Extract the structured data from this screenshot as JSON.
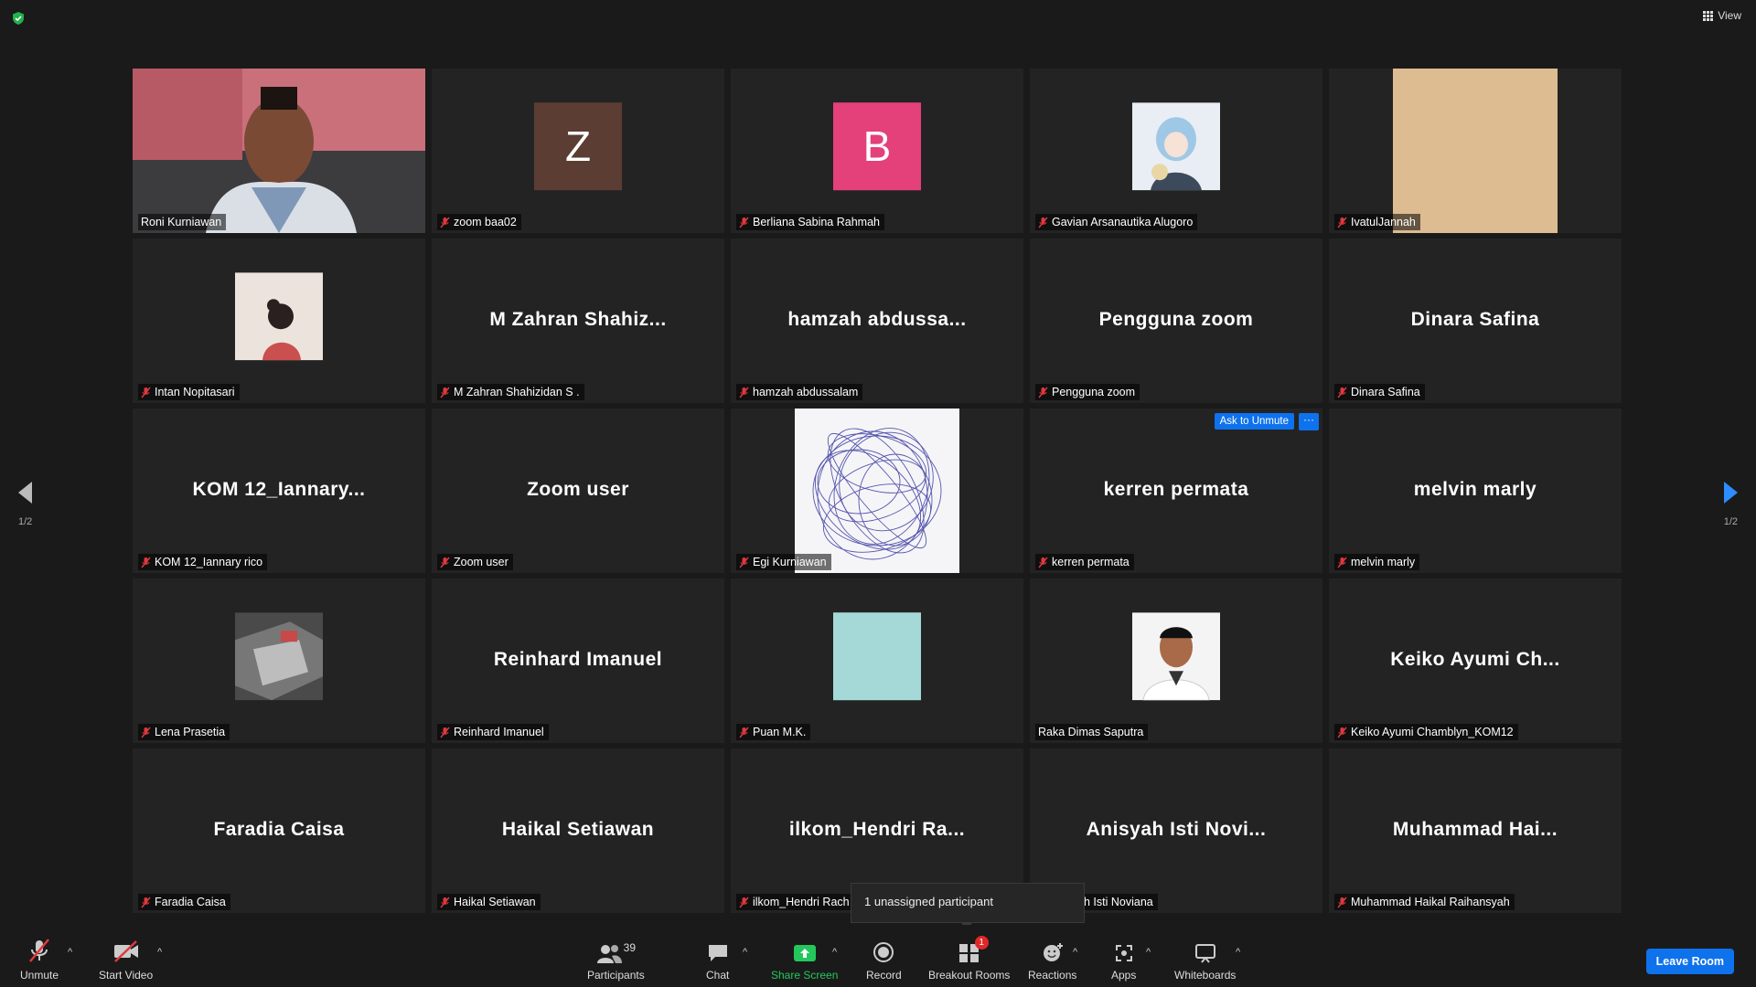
{
  "topbar": {
    "view_label": "View"
  },
  "tiles": [
    {
      "name": "Roni Kurniawan",
      "muted": false,
      "active": true,
      "type": "video",
      "desc": "webcam"
    },
    {
      "name": "zoom baa02",
      "muted": true,
      "type": "letter",
      "letter": "Z",
      "color": "#5b3d33"
    },
    {
      "name": "Berliana Sabina Rahmah",
      "muted": true,
      "type": "letter",
      "letter": "B",
      "color": "#e4407a"
    },
    {
      "name": "Gavian Arsanautika Alugoro",
      "muted": true,
      "type": "image",
      "desc": "anime avatar"
    },
    {
      "name": "IvatulJannah",
      "muted": true,
      "type": "video",
      "desc": "beige camera"
    },
    {
      "name": "Intan Nopitasari",
      "muted": true,
      "type": "image",
      "desc": "drawing avatar"
    },
    {
      "name": "M Zahran Shahizidan S .",
      "muted": true,
      "type": "text",
      "big": "M Zahran Shahiz..."
    },
    {
      "name": "hamzah abdussalam",
      "muted": true,
      "type": "text",
      "big": "hamzah abdussa..."
    },
    {
      "name": "Pengguna zoom",
      "muted": true,
      "type": "text",
      "big": "Pengguna zoom"
    },
    {
      "name": "Dinara Safina",
      "muted": true,
      "type": "text",
      "big": "Dinara Safina"
    },
    {
      "name": "KOM 12_Iannary rico",
      "muted": true,
      "type": "text",
      "big": "KOM 12_Iannary..."
    },
    {
      "name": "Zoom user",
      "muted": true,
      "type": "text",
      "big": "Zoom user"
    },
    {
      "name": "Egi Kurniawan",
      "muted": true,
      "type": "video",
      "desc": "scribble"
    },
    {
      "name": "kerren permata",
      "muted": true,
      "type": "text",
      "big": "kerren permata",
      "ask_unmute": "Ask to Unmute",
      "more": "···"
    },
    {
      "name": "melvin marly",
      "muted": true,
      "type": "text",
      "big": "melvin marly"
    },
    {
      "name": "Lena Prasetia",
      "muted": true,
      "type": "image",
      "desc": "photo"
    },
    {
      "name": "Reinhard Imanuel",
      "muted": true,
      "type": "text",
      "big": "Reinhard Imanuel"
    },
    {
      "name": "Puan M.K.",
      "muted": true,
      "type": "image",
      "desc": "teal square",
      "color": "#a4d9d8"
    },
    {
      "name": "Raka Dimas Saputra",
      "muted": false,
      "type": "image",
      "desc": "portrait"
    },
    {
      "name": "Keiko Ayumi Chamblyn_KOM12",
      "muted": true,
      "type": "text",
      "big": "Keiko Ayumi Ch..."
    },
    {
      "name": "Faradia Caisa",
      "muted": true,
      "type": "text",
      "big": "Faradia Caisa"
    },
    {
      "name": "Haikal Setiawan",
      "muted": true,
      "type": "text",
      "big": "Haikal Setiawan"
    },
    {
      "name": "ilkom_Hendri Rach",
      "muted": true,
      "type": "text",
      "big": "ilkom_Hendri Ra..."
    },
    {
      "name": "h Isti Noviana",
      "muted": false,
      "type": "text",
      "big": "Anisyah Isti Novi..."
    },
    {
      "name": "Muhammad Haikal Raihansyah",
      "muted": true,
      "type": "text",
      "big": "Muhammad Hai..."
    }
  ],
  "pager": {
    "left": "1/2",
    "right": "1/2"
  },
  "tooltip": "1 unassigned participant",
  "toolbar": {
    "unmute": "Unmute",
    "start_video": "Start Video",
    "participants": "Participants",
    "participants_count": "39",
    "chat": "Chat",
    "share_screen": "Share Screen",
    "record": "Record",
    "breakout_rooms": "Breakout Rooms",
    "breakout_badge": "1",
    "reactions": "Reactions",
    "apps": "Apps",
    "whiteboards": "Whiteboards",
    "leave": "Leave Room"
  },
  "colors": {
    "accent": "#0e72ed",
    "active_border": "#d8ee5a",
    "share_green": "#24c75b",
    "muted_red": "#e0383e"
  }
}
